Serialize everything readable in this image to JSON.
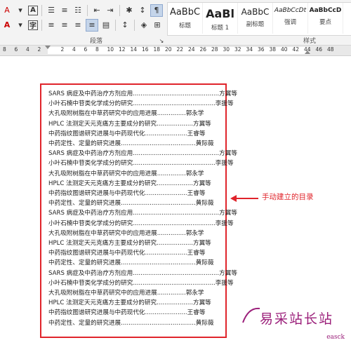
{
  "ribbon": {
    "paragraph_label": "段落",
    "styles_label": "样式",
    "styles": [
      {
        "sample": "AaBbC",
        "name": "标题"
      },
      {
        "sample": "AaBl",
        "name": "标题 1"
      },
      {
        "sample": "AaBbC",
        "name": "副标题"
      },
      {
        "sample": "AaBbCcDt",
        "name": "强调"
      },
      {
        "sample": "AaBbCcD",
        "name": "要点"
      }
    ]
  },
  "ruler": {
    "numbers": [
      "8",
      "6",
      "4",
      "2",
      "",
      "2",
      "4",
      "6",
      "8",
      "10",
      "12",
      "14",
      "16",
      "18",
      "20",
      "22",
      "24",
      "26",
      "28",
      "30",
      "32",
      "34",
      "36",
      "38",
      "40",
      "42",
      "44",
      "46",
      "48"
    ]
  },
  "toc": [
    {
      "title": "SARS 病症及中药治疗方剂应用",
      "dots": ".............................................",
      "author": "方翼等"
    },
    {
      "title": "小叶石楠中苷类化学成分的研究",
      "dots": "...........................................",
      "author": "李援等"
    },
    {
      "title": "大孔吸附树脂在中草药研究中的应用进展",
      "dots": "...............",
      "author": "郭永学"
    },
    {
      "title": "HPLC 法测定天元克痛方主要成分的研究",
      "dots": "...................",
      "author": "方翼等"
    },
    {
      "title": "中药指纹图谱研究进展与中药现代化",
      "dots": "......................",
      "author": "王睿等"
    },
    {
      "title": "中药定性、定量的研究进展",
      "dots": ".......................................",
      "author": "黄际薇"
    },
    {
      "title": "SARS 病症及中药治疗方剂应用",
      "dots": ".............................................",
      "author": "方翼等"
    },
    {
      "title": "小叶石楠中苷类化学成分的研究",
      "dots": "...........................................",
      "author": "李援等"
    },
    {
      "title": "大孔吸附树脂在中草药研究中的应用进展",
      "dots": "...............",
      "author": "郭永学"
    },
    {
      "title": "HPLC 法测定天元克痛方主要成分的研究",
      "dots": "...................",
      "author": "方翼等"
    },
    {
      "title": "中药指纹图谱研究进展与中药现代化",
      "dots": "......................",
      "author": "王睿等"
    },
    {
      "title": "中药定性、定量的研究进展",
      "dots": ".......................................",
      "author": "黄际薇"
    },
    {
      "title": "SARS 病症及中药治疗方剂应用",
      "dots": ".............................................",
      "author": "方翼等"
    },
    {
      "title": "小叶石楠中苷类化学成分的研究",
      "dots": "...........................................",
      "author": "李援等"
    },
    {
      "title": "大孔吸附树脂在中草药研究中的应用进展",
      "dots": "...............",
      "author": "郭永学"
    },
    {
      "title": "HPLC 法测定天元克痛方主要成分的研究",
      "dots": "...................",
      "author": "方翼等"
    },
    {
      "title": "中药指纹图谱研究进展与中药现代化",
      "dots": "......................",
      "author": "王睿等"
    },
    {
      "title": "中药定性、定量的研究进展",
      "dots": ".......................................",
      "author": "黄际薇"
    },
    {
      "title": "SARS 病症及中药治疗方剂应用",
      "dots": ".............................................",
      "author": "方翼等"
    },
    {
      "title": "小叶石楠中苷类化学成分的研究",
      "dots": "...........................................",
      "author": "李援等"
    },
    {
      "title": "大孔吸附树脂在中草药研究中的应用进展",
      "dots": "...............",
      "author": "郭永学"
    },
    {
      "title": "HPLC 法测定天元克痛方主要成分的研究",
      "dots": "...................",
      "author": "方翼等"
    },
    {
      "title": "中药指纹图谱研究进展与中药现代化",
      "dots": "......................",
      "author": "王睿等"
    },
    {
      "title": "中药定性、定量的研究进展",
      "dots": ".......................................",
      "author": "黄际薇"
    }
  ],
  "annotation": "手动建立的目录",
  "watermark": {
    "main": "易采站长站",
    "sub": "easck"
  },
  "colors": {
    "highlight": "#e0242b",
    "watermark": "#9b1f7a"
  }
}
